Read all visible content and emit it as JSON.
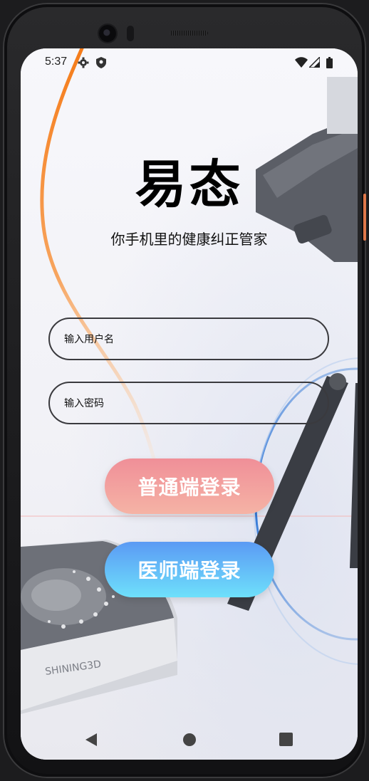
{
  "status_bar": {
    "time": "5:37",
    "left_icons": [
      "gear-icon",
      "shield-icon"
    ],
    "right_icons": [
      "wifi-icon",
      "signal-icon",
      "battery-icon"
    ]
  },
  "app": {
    "title": "易态",
    "subtitle": "你手机里的健康纠正管家"
  },
  "form": {
    "username_placeholder": "输入用户名",
    "username_value": "",
    "password_placeholder": "输入密码",
    "password_value": ""
  },
  "buttons": {
    "normal_login": "普通端登录",
    "doctor_login": "医师端登录"
  },
  "navigation": {
    "icons": [
      "back-icon",
      "home-icon",
      "recents-icon"
    ]
  },
  "background_text": {
    "device_brand": "SHINING3D"
  },
  "colors": {
    "normal_button_top": "#f08f98",
    "normal_button_bottom": "#f5b3a5",
    "doctor_button_top": "#5b9af4",
    "doctor_button_bottom": "#6ee0fb",
    "field_border": "#3a3a3e",
    "decor_orange": "#f57c1a",
    "decor_blue": "#2b74d6"
  }
}
